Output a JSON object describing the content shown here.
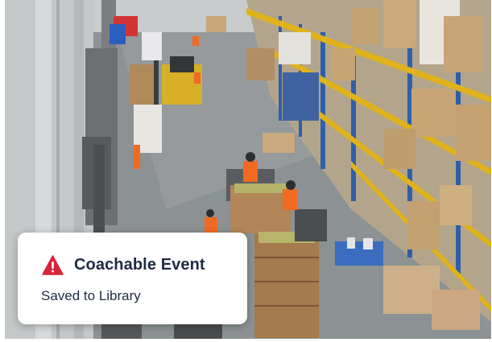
{
  "notification": {
    "title": "Coachable Event",
    "subtitle": "Saved to Library",
    "icon": "warning-triangle-icon",
    "icon_color": "#d6243a"
  },
  "scene": {
    "description_tag": "warehouse-camera-frame"
  },
  "colors": {
    "text": "#1f2a44",
    "toast_bg": "#ffffff",
    "rack_blue": "#2f5fa8",
    "rack_yellow": "#e0b21b",
    "worker_vest": "#f06a24"
  }
}
